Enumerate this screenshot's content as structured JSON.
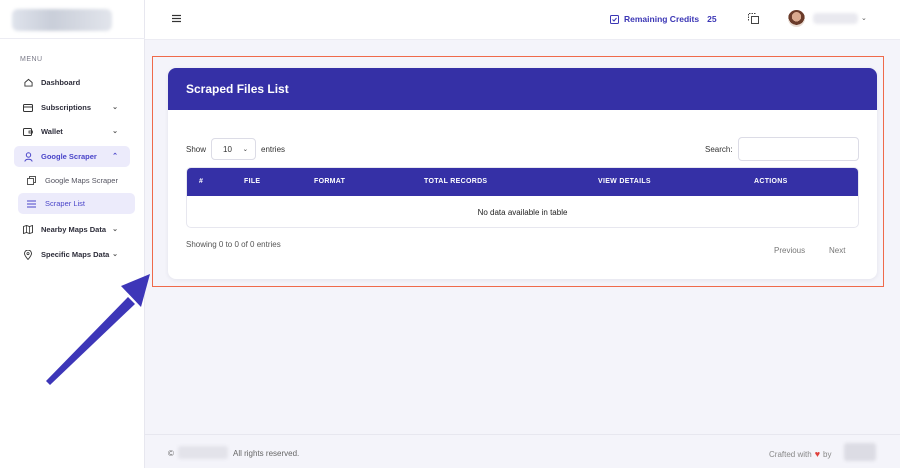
{
  "sidebar": {
    "menu_label": "MENU",
    "items": [
      {
        "label": "Dashboard",
        "icon": "home-icon"
      },
      {
        "label": "Subscriptions",
        "icon": "card-icon"
      },
      {
        "label": "Wallet",
        "icon": "wallet-icon"
      },
      {
        "label": "Google Scraper",
        "icon": "user-icon"
      },
      {
        "label": "Google Maps Scraper",
        "icon": "copy-icon"
      },
      {
        "label": "Scraper List",
        "icon": "list-icon"
      },
      {
        "label": "Nearby Maps Data",
        "icon": "map-icon"
      },
      {
        "label": "Specific Maps Data",
        "icon": "pin-icon"
      }
    ]
  },
  "header": {
    "credits_label": "Remaining Credits",
    "credits_value": "25"
  },
  "card": {
    "title": "Scraped Files List",
    "show_label": "Show",
    "entries_value": "10",
    "entries_label": "entries",
    "search_label": "Search:",
    "search_value": "",
    "columns": [
      "#",
      "FILE",
      "FORMAT",
      "TOTAL RECORDS",
      "VIEW DETAILS",
      "ACTIONS"
    ],
    "empty_message": "No data available in table",
    "info": "Showing 0 to 0 of 0 entries",
    "prev": "Previous",
    "next": "Next"
  },
  "footer": {
    "copyright_symbol": "©",
    "rights": "All rights reserved.",
    "crafted": "Crafted with",
    "by": "by"
  },
  "colors": {
    "accent": "#3530a6",
    "highlight_border": "#ef6a4a",
    "arrow": "#3d36b8",
    "heart": "#e0403c"
  }
}
